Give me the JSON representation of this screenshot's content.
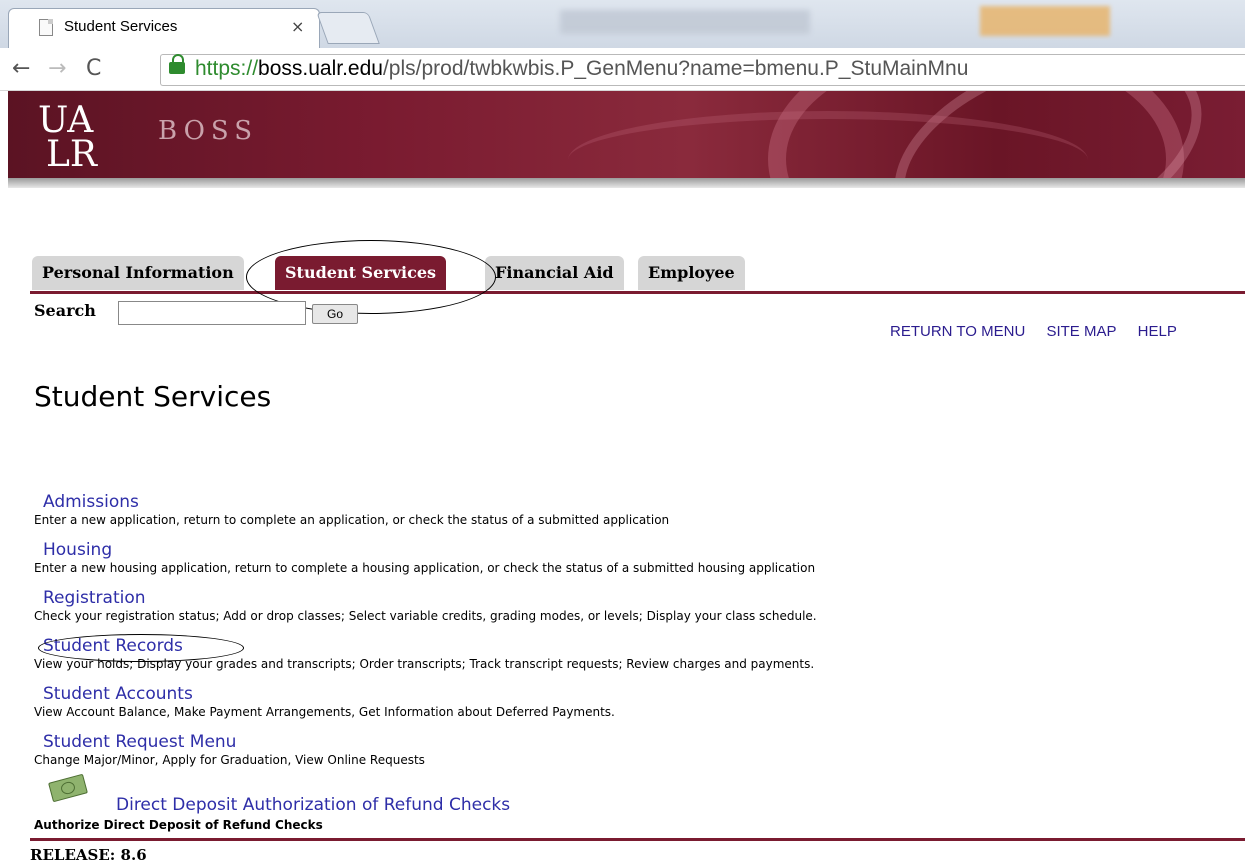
{
  "browser": {
    "tab_title": "Student Services",
    "tab_close": "×",
    "url_scheme": "https://",
    "url_host": "boss.ualr.edu",
    "url_path": "/pls/prod/twbkwbis.P_GenMenu?name=bmenu.P_StuMainMnu",
    "back_glyph": "←",
    "forward_glyph": "→",
    "reload_glyph": "C"
  },
  "banner": {
    "logo_line1": "UA",
    "logo_line2": "LR",
    "title": "BOSS"
  },
  "nav_tabs": [
    {
      "label": "Personal Information",
      "active": false
    },
    {
      "label": "Student Services",
      "active": true
    },
    {
      "label": "Financial Aid",
      "active": false
    },
    {
      "label": "Employee",
      "active": false
    }
  ],
  "search": {
    "label": "Search",
    "value": "",
    "button_label": "Go"
  },
  "utility_links": [
    "RETURN TO MENU",
    "SITE MAP",
    "HELP"
  ],
  "page_title": "Student Services",
  "menu": [
    {
      "label": "Admissions",
      "description": "Enter a new application, return to complete an application, or check the status of a submitted application"
    },
    {
      "label": "Housing",
      "description": "Enter a new housing application, return to complete a housing application, or check the status of a submitted housing application"
    },
    {
      "label": "Registration",
      "description": "Check your registration status; Add or drop classes; Select variable credits, grading modes, or levels; Display your class schedule."
    },
    {
      "label": "Student Records",
      "description": "View your holds; Display your grades and transcripts; Order transcripts; Track transcript requests; Review charges and payments."
    },
    {
      "label": "Student Accounts",
      "description": "View Account Balance, Make Payment Arrangements, Get Information about Deferred Payments."
    },
    {
      "label": "Student Request Menu",
      "description": "Change Major/Minor, Apply for Graduation, View Online Requests"
    }
  ],
  "direct_deposit": {
    "icon": "money-icon",
    "label": "Direct Deposit Authorization of Refund Checks",
    "description": "Authorize Direct Deposit of Refund Checks"
  },
  "footer": {
    "release": "RELEASE: 8.6"
  },
  "colors": {
    "brand_maroon": "#7a1b30",
    "link_blue": "#2e2ea8",
    "utility_link": "#2b1c8e"
  }
}
